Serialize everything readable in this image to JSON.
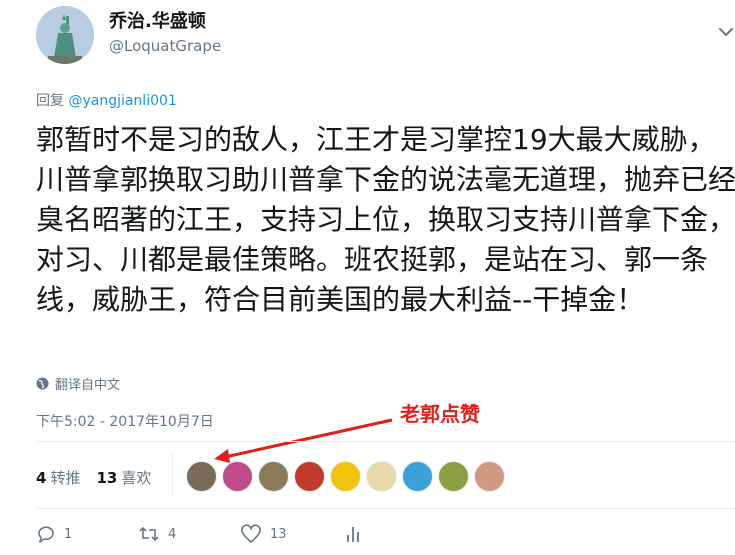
{
  "user": {
    "display_name": "乔治.华盛顿",
    "handle": "@LoquatGrape",
    "avatar_icon": "statue-of-liberty-avatar"
  },
  "reply": {
    "prefix": "回复 ",
    "to": "@yangjianli001"
  },
  "tweet": {
    "text": "郭暂时不是习的敌人，江王才是习掌控19大最大威胁，川普拿郭换取习助川普拿下金的说法毫无道理，抛弃已经臭名昭著的江王，支持习上位，换取习支持川普拿下金，对习、川都是最佳策略。班农挺郭，是站在习、郭一条线，威胁王，符合目前美国的最大利益--干掉金！",
    "translate_label": "翻译自中文",
    "timestamp": "下午5:02 - 2017年10月7日"
  },
  "annotation": {
    "text": "老郭点赞",
    "color": "#e0201a"
  },
  "stats": {
    "retweets_count": "4",
    "retweets_label": "转推",
    "likes_count": "13",
    "likes_label": "喜欢"
  },
  "likers": [
    {
      "name": "liker-1",
      "color": "#7a6a5a"
    },
    {
      "name": "liker-2",
      "color": "#c04a8a"
    },
    {
      "name": "liker-3",
      "color": "#8a7a5a"
    },
    {
      "name": "liker-4",
      "color": "#c0392b"
    },
    {
      "name": "liker-5",
      "color": "#f1c40f"
    },
    {
      "name": "liker-6",
      "color": "#e8d9a8"
    },
    {
      "name": "liker-7",
      "color": "#3aa0d8"
    },
    {
      "name": "liker-8",
      "color": "#8aa040"
    },
    {
      "name": "liker-9",
      "color": "#d09a80"
    }
  ],
  "actions": {
    "reply_count": "1",
    "retweet_count": "4",
    "like_count": "13"
  },
  "colors": {
    "link": "#1b95e0",
    "secondary_text": "#657786",
    "divider": "#e6ecf0"
  }
}
